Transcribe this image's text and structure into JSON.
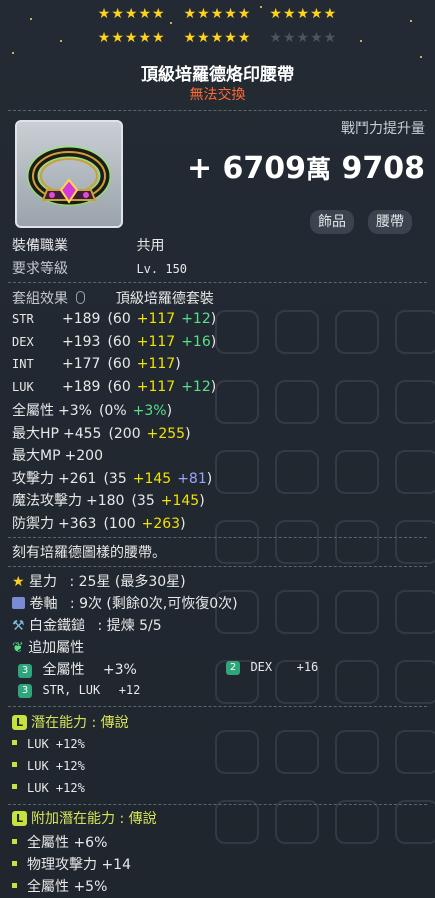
{
  "stars": {
    "filled": 25,
    "total": 30
  },
  "item": {
    "name": "頂級培羅德烙印腰帶",
    "trade_status": "無法交換",
    "combat_power_label": "戰鬥力提升量",
    "combat_power_prefix": "+",
    "combat_power_a": "6709",
    "combat_power_unit": "萬",
    "combat_power_b": "9708",
    "tags": [
      "飾品",
      "腰帶"
    ]
  },
  "requirements": [
    {
      "label": "裝備職業",
      "value": "共用"
    },
    {
      "label": "要求等級",
      "value": "Lv. 150"
    }
  ],
  "set": {
    "label": "套組效果",
    "value": "頂級培羅德套裝"
  },
  "stats": [
    {
      "name": "STR",
      "total": "+189",
      "base": "(60",
      "a": "+117",
      "b": "+12",
      "close": ")"
    },
    {
      "name": "DEX",
      "total": "+193",
      "base": "(60",
      "a": "+117",
      "b": "+16",
      "close": ")"
    },
    {
      "name": "INT",
      "total": "+177",
      "base": "(60",
      "a": "+117",
      "b": "",
      "close": ")"
    },
    {
      "name": "LUK",
      "total": "+189",
      "base": "(60",
      "a": "+117",
      "b": "+12",
      "close": ")"
    }
  ],
  "stats2": [
    {
      "name": "全屬性",
      "total": "+3%",
      "base": "(0%",
      "a": "",
      "b": "+3%",
      "close": ")"
    },
    {
      "name": "最大HP",
      "total": "+455",
      "base": "(200",
      "a": "+255",
      "b": "",
      "close": ")"
    },
    {
      "name": "最大MP",
      "total": "+200",
      "base": "",
      "a": "",
      "b": "",
      "close": ""
    },
    {
      "name": "攻擊力",
      "total": "+261",
      "base": "(35",
      "a": "+145",
      "c": "+81",
      "close": ")"
    },
    {
      "name": "魔法攻擊力",
      "total": "+180",
      "base": "(35",
      "a": "+145",
      "b": "",
      "close": ")"
    },
    {
      "name": "防禦力",
      "total": "+363",
      "base": "(100",
      "a": "+263",
      "b": "",
      "close": ")"
    }
  ],
  "description": "刻有培羅德圖樣的腰帶。",
  "upgrades": [
    {
      "icon": "star-icon",
      "label": "星力",
      "value": ": 25星 (最多30星)"
    },
    {
      "icon": "scroll-icon",
      "label": "卷軸",
      "value": ": 9次 (剩餘0次,可恢復0次)"
    },
    {
      "icon": "hammer-icon",
      "label": "白金鐵鎚",
      "value": ": 提煉 5/5"
    }
  ],
  "additional": {
    "label": "追加屬性",
    "lines": [
      {
        "badge": "3",
        "name": "全屬性",
        "value": "+3%"
      },
      {
        "badge": "2",
        "name": "DEX",
        "value": "+16"
      },
      {
        "badge": "3",
        "name": "STR, LUK",
        "value": "+12"
      }
    ]
  },
  "potential": {
    "badge": "L",
    "title": "潛在能力 : 傳說",
    "lines": [
      "LUK +12%",
      "LUK +12%",
      "LUK +12%"
    ]
  },
  "bonus_potential": {
    "badge": "L",
    "title": "附加潛在能力 : 傳說",
    "lines": [
      "全屬性 +6%",
      "物理攻擊力 +14",
      "全屬性 +5%"
    ]
  },
  "colors": {
    "yellow": "#f2e200",
    "green": "#58e08a",
    "violet": "#9aa5ff",
    "title_orange": "#ff6a34",
    "potential": "#d6e35a"
  }
}
